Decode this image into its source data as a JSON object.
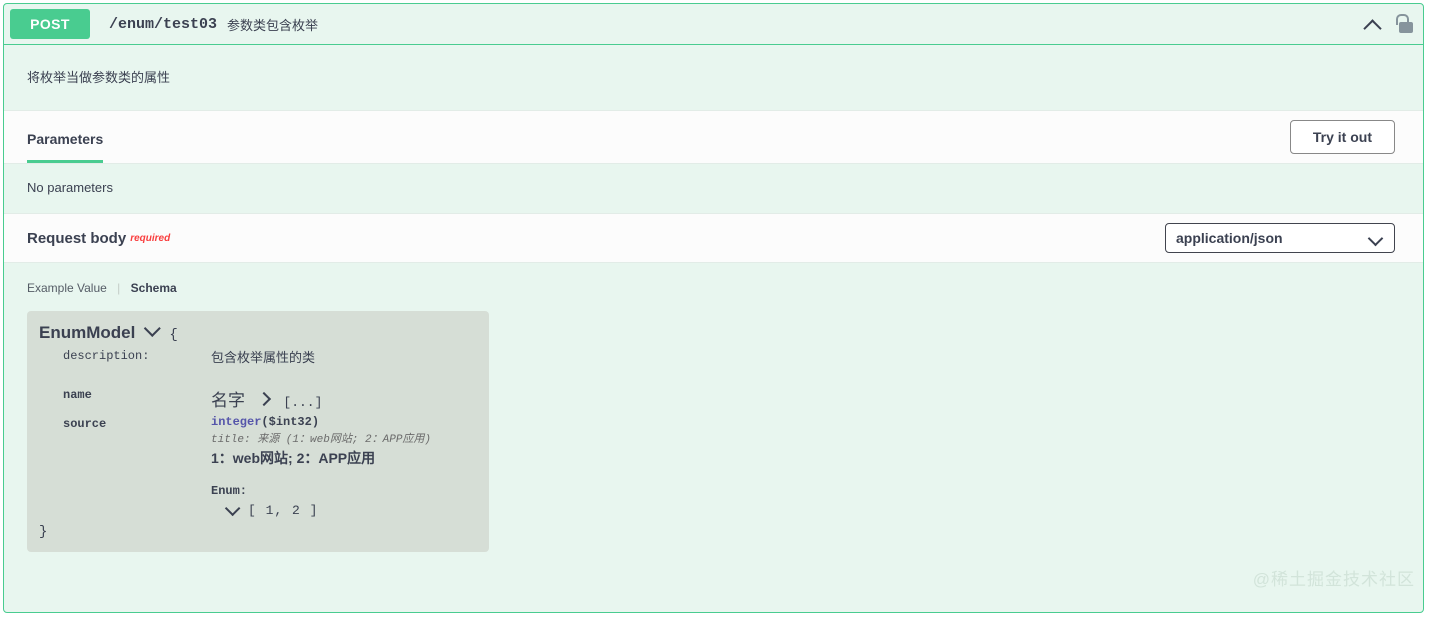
{
  "operation": {
    "method": "POST",
    "path": "/enum/test03",
    "summary": "参数类包含枚举",
    "description": "将枚举当做参数类的属性",
    "collapse_icon": "chevron-up-icon",
    "auth_icon": "unlocked-padlock-icon"
  },
  "parameters_section": {
    "tab_label": "Parameters",
    "try_it_out_label": "Try it out",
    "empty_text": "No parameters"
  },
  "request_body": {
    "title": "Request body",
    "required_label": "required",
    "content_type": "application/json",
    "content_type_options": [
      "application/json"
    ],
    "example_tab": "Example Value",
    "schema_tab": "Schema"
  },
  "model": {
    "name": "EnumModel",
    "open_brace": "{",
    "close_brace": "}",
    "rows": [
      {
        "key": "description:",
        "value": "包含枚举属性的类"
      },
      {
        "key": "name",
        "zh_title": "名字",
        "collapsed_value": "[...]"
      },
      {
        "key": "source",
        "type": "integer",
        "format": "($int32)",
        "title_line": "title: 来源 (1：web网站; 2：APP应用)",
        "enum_description": "1：web网站;  2：APP应用",
        "enum_label": "Enum:",
        "enum_values": "[ 1, 2 ]"
      }
    ]
  },
  "watermark": "@稀土掘金技术社区",
  "colors": {
    "method_green": "#49cc90",
    "panel_bg": "#e8f6ef",
    "model_bg": "#d6ded6",
    "required_red": "#f93e3e",
    "type_blue": "#5555aa"
  }
}
